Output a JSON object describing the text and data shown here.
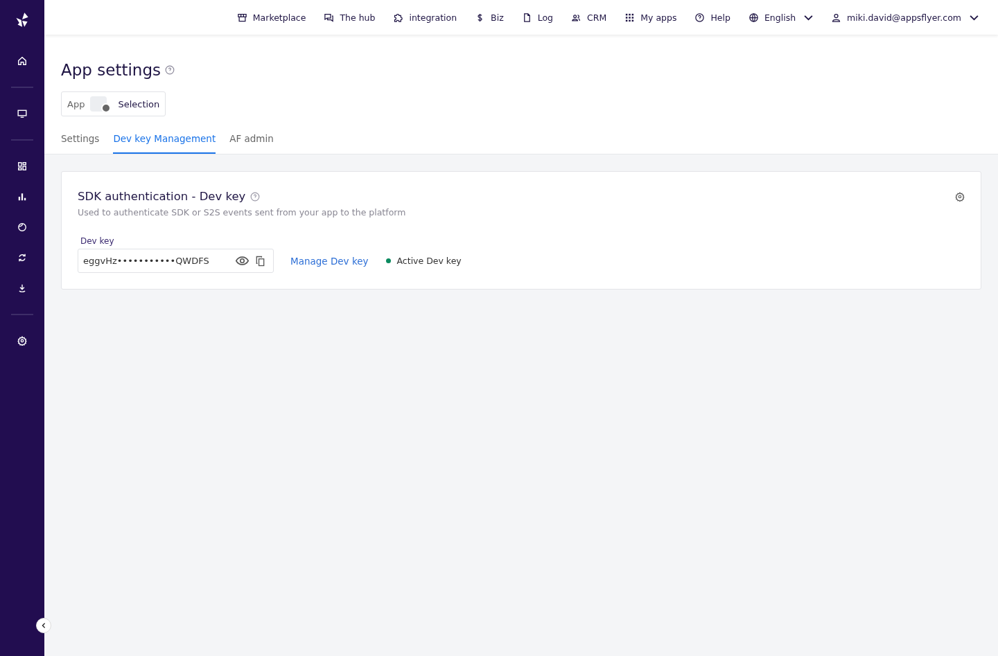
{
  "top_nav": [
    {
      "label": "Marketplace"
    },
    {
      "label": "The hub"
    },
    {
      "label": "integration"
    },
    {
      "label": "Biz"
    },
    {
      "label": "Log"
    },
    {
      "label": "CRM"
    },
    {
      "label": "My apps"
    },
    {
      "label": "Help"
    },
    {
      "label": "English"
    },
    {
      "label": "miki.david@appsflyer.com"
    }
  ],
  "page": {
    "title": "App settings"
  },
  "app_selector": {
    "label": "App",
    "value": "Selection"
  },
  "tabs": [
    {
      "label": "Settings",
      "selected": false
    },
    {
      "label": "Dev key Management",
      "selected": true
    },
    {
      "label": "AF admin",
      "selected": false
    }
  ],
  "card": {
    "title": "SDK authentication - Dev key",
    "description": "Used to authenticate SDK or S2S events sent from your app to the platform",
    "field_label": "Dev key",
    "value": "eggvHz•••••••••••QWDFS",
    "link": "Manage Dev key",
    "status": {
      "label": "Active Dev key",
      "active": true
    }
  }
}
